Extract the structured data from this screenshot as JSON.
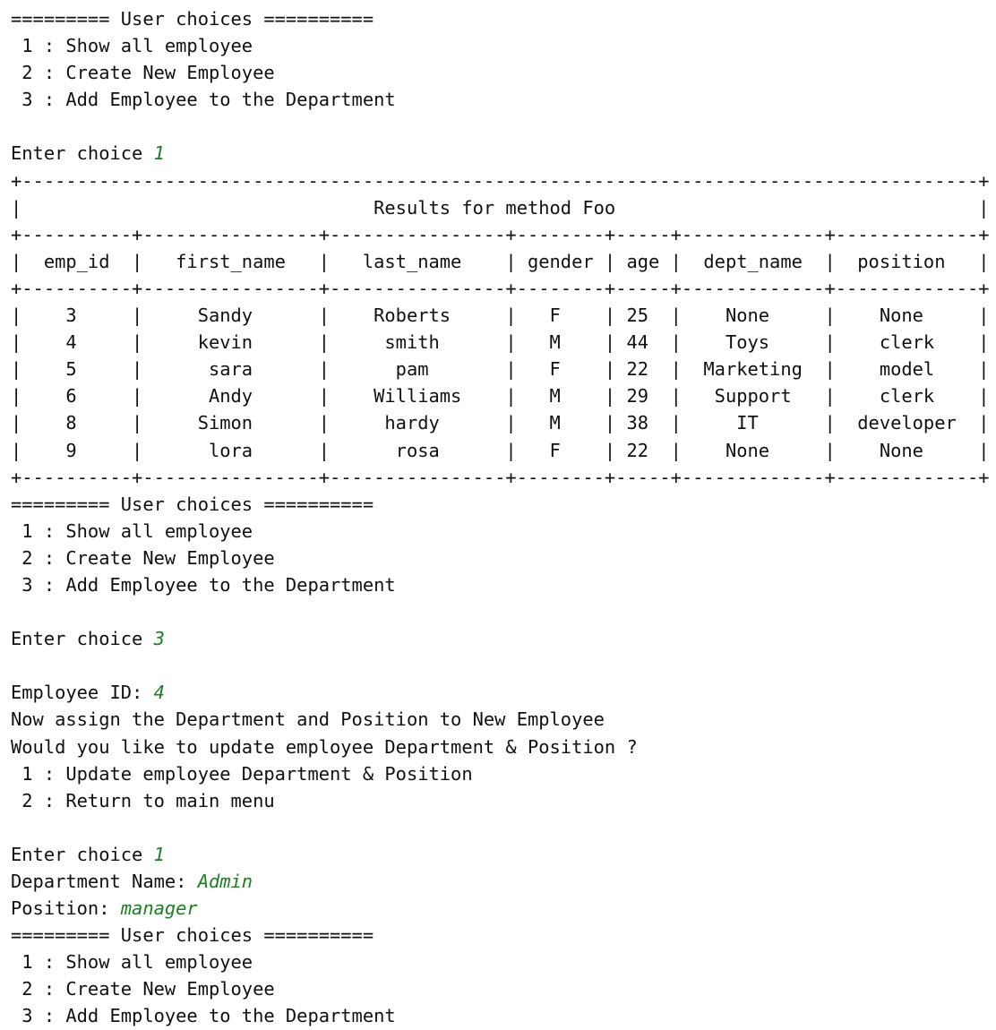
{
  "terminal": {
    "background": "#ffffff",
    "foreground": "#111111",
    "input_color": "#1a8020",
    "font_size_px": 20,
    "line_height_px": 30,
    "columns": 86
  },
  "menu": {
    "banner": "========= User choices ==========",
    "banner_left_equals": 9,
    "banner_right_equals": 10,
    "banner_title": "User choices",
    "items": [
      {
        "key": "1",
        "label": "Show all employee"
      },
      {
        "key": "2",
        "label": "Create New Employee"
      },
      {
        "key": "3",
        "label": "Add Employee to the Department"
      }
    ]
  },
  "prompts": {
    "enter_choice": "Enter choice ",
    "employee_id": "Employee ID: ",
    "department_name": "Department Name: ",
    "position": "Position: "
  },
  "submenu": {
    "assign_notice": "Now assign the Department and Position to New Employee",
    "question": "Would you like to update employee Department & Position ?",
    "items": [
      {
        "key": "1",
        "label": "Update employee Department & Position"
      },
      {
        "key": "2",
        "label": "Return to main menu"
      }
    ]
  },
  "inputs": {
    "first_choice": "1",
    "second_choice": "3",
    "employee_id": "4",
    "submenu_choice": "1",
    "department_name": "Admin",
    "position": "manager"
  },
  "table": {
    "title": "Results for method Foo",
    "border_char_corner": "+",
    "border_char_horizontal": "-",
    "border_char_vertical": "|",
    "columns": [
      {
        "name": "emp_id",
        "width": 10
      },
      {
        "name": "first_name",
        "width": 16
      },
      {
        "name": "last_name",
        "width": 16
      },
      {
        "name": "gender",
        "width": 8
      },
      {
        "name": "age",
        "width": 5
      },
      {
        "name": "dept_name",
        "width": 13
      },
      {
        "name": "position",
        "width": 13
      }
    ],
    "rows": [
      {
        "emp_id": "3",
        "first_name": "Sandy",
        "last_name": "Roberts",
        "gender": "F",
        "age": "25",
        "dept_name": "None",
        "position": "None"
      },
      {
        "emp_id": "4",
        "first_name": "kevin",
        "last_name": "smith",
        "gender": "M",
        "age": "44",
        "dept_name": "Toys",
        "position": "clerk"
      },
      {
        "emp_id": "5",
        "first_name": "sara",
        "last_name": "pam",
        "gender": "F",
        "age": "22",
        "dept_name": "Marketing",
        "position": "model"
      },
      {
        "emp_id": "6",
        "first_name": "Andy",
        "last_name": "Williams",
        "gender": "M",
        "age": "29",
        "dept_name": "Support",
        "position": "clerk"
      },
      {
        "emp_id": "8",
        "first_name": "Simon",
        "last_name": "hardy",
        "gender": "M",
        "age": "38",
        "dept_name": "IT",
        "position": "developer"
      },
      {
        "emp_id": "9",
        "first_name": "lora",
        "last_name": "rosa",
        "gender": "F",
        "age": "22",
        "dept_name": "None",
        "position": "None"
      }
    ]
  }
}
